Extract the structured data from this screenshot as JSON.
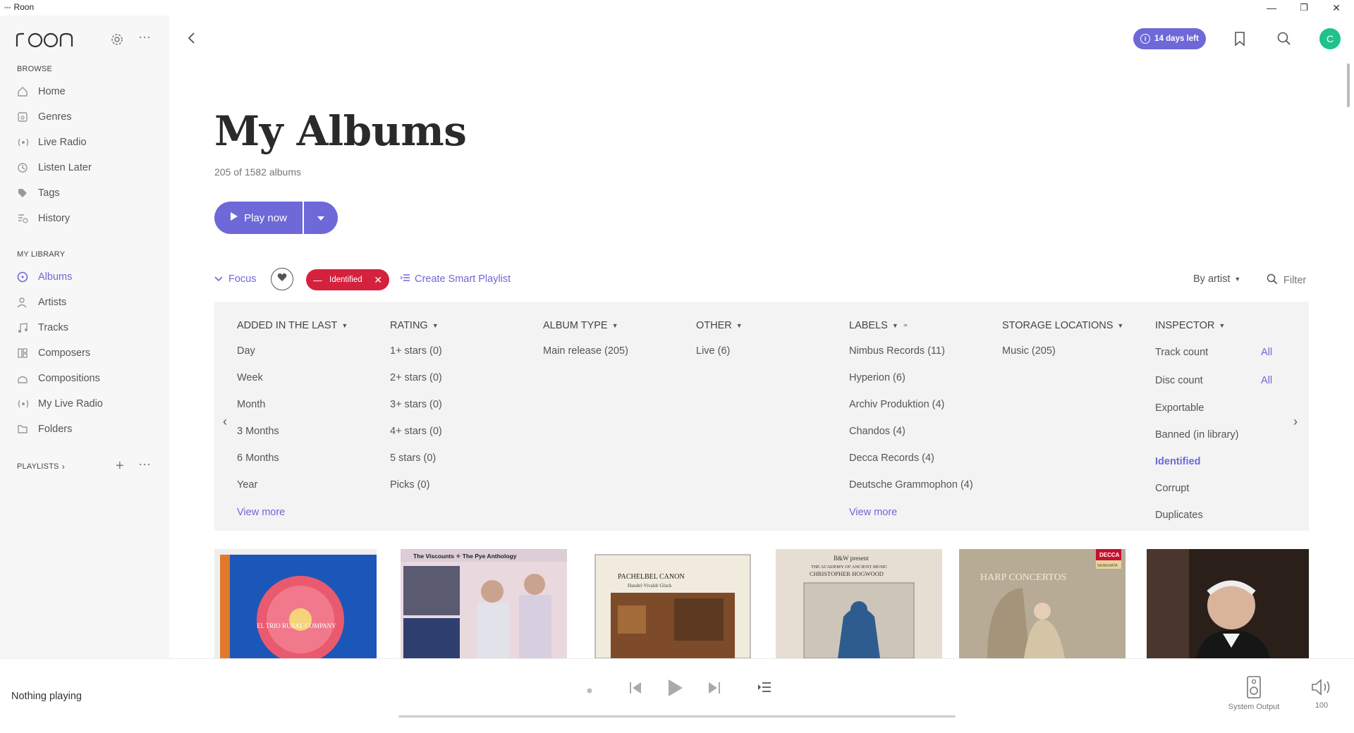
{
  "window": {
    "app_title": "Roon",
    "minimize": "—",
    "restore": "❐",
    "close": "✕"
  },
  "sidebar": {
    "browse_title": "BROWSE",
    "browse_items": [
      {
        "label": "Home",
        "icon": "home-icon"
      },
      {
        "label": "Genres",
        "icon": "genres-icon"
      },
      {
        "label": "Live Radio",
        "icon": "radio-icon"
      },
      {
        "label": "Listen Later",
        "icon": "clock-icon"
      },
      {
        "label": "Tags",
        "icon": "tag-icon"
      },
      {
        "label": "History",
        "icon": "history-icon"
      }
    ],
    "library_title": "MY LIBRARY",
    "library_items": [
      {
        "label": "Albums",
        "icon": "album-icon",
        "active": true
      },
      {
        "label": "Artists",
        "icon": "artist-icon"
      },
      {
        "label": "Tracks",
        "icon": "music-note-icon"
      },
      {
        "label": "Composers",
        "icon": "composer-icon"
      },
      {
        "label": "Compositions",
        "icon": "composition-icon"
      },
      {
        "label": "My Live Radio",
        "icon": "radio-icon"
      },
      {
        "label": "Folders",
        "icon": "folder-icon"
      }
    ],
    "playlists_title": "PLAYLISTS"
  },
  "header": {
    "trial_badge": "14 days left",
    "avatar_initial": "C"
  },
  "page": {
    "title": "My Albums",
    "count": "205 of 1582 albums",
    "play_label": "Play now"
  },
  "toolbar": {
    "focus_label": "Focus",
    "chip_label": "Identified",
    "smart_playlist": "Create Smart Playlist",
    "sort_label": "By artist",
    "filter_label": "Filter"
  },
  "focus_panel": {
    "columns": [
      {
        "title": "ADDED IN THE LAST",
        "items": [
          "Day",
          "Week",
          "Month",
          "3 Months",
          "6 Months",
          "Year"
        ],
        "more": "View more"
      },
      {
        "title": "RATING",
        "items": [
          "1+ stars (0)",
          "2+ stars (0)",
          "3+ stars (0)",
          "4+ stars (0)",
          "5 stars (0)",
          "Picks (0)"
        ]
      },
      {
        "title": "ALBUM TYPE",
        "items": [
          "Main release (205)"
        ]
      },
      {
        "title": "OTHER",
        "items": [
          "Live (6)"
        ]
      },
      {
        "title": "LABELS",
        "items": [
          "Nimbus Records (11)",
          "Hyperion (6)",
          "Archiv Produktion (4)",
          "Chandos (4)",
          "Decca Records (4)",
          "Deutsche Grammophon (4)"
        ],
        "more": "View more"
      },
      {
        "title": "STORAGE LOCATIONS",
        "items": [
          "Music (205)"
        ]
      },
      {
        "title": "INSPECTOR",
        "items": [
          "Track count",
          "Disc count",
          "Exportable",
          "Banned (in library)",
          "Identified",
          "Corrupt",
          "Duplicates"
        ],
        "all_labels": [
          "All",
          "All"
        ]
      }
    ]
  },
  "albums": [
    {
      "cover_text": "EL TRIO RURAL COMPANY",
      "colors": [
        "#1b57b8",
        "#e95a6f"
      ]
    },
    {
      "cover_text": "The Viscounts ✧ The Pye Anthology",
      "colors": [
        "#e9d9de",
        "#5a5a70"
      ]
    },
    {
      "cover_text": "PACHELBEL CANON",
      "sub_text": "Handel·Vivaldi·Gluck",
      "colors": [
        "#f1ebde",
        "#7d4b2a"
      ]
    },
    {
      "cover_text": "B&W present",
      "sub_text": "THE ACADEMY OF ANCIENT MUSIC",
      "sub_text2": "CHRISTOPHER HOGWOOD",
      "colors": [
        "#e6ded2",
        "#2e5c8f"
      ]
    },
    {
      "cover_text": "HARP CONCERTOS",
      "badge": "DECCA",
      "badge2": "SERENATA",
      "colors": [
        "#b7ab96",
        "#d3c5a5"
      ]
    },
    {
      "cover_text": "",
      "colors": [
        "#2b1f1a",
        "#d9b39a"
      ]
    }
  ],
  "player": {
    "status": "Nothing playing",
    "output_label": "System Output",
    "volume": "100"
  }
}
